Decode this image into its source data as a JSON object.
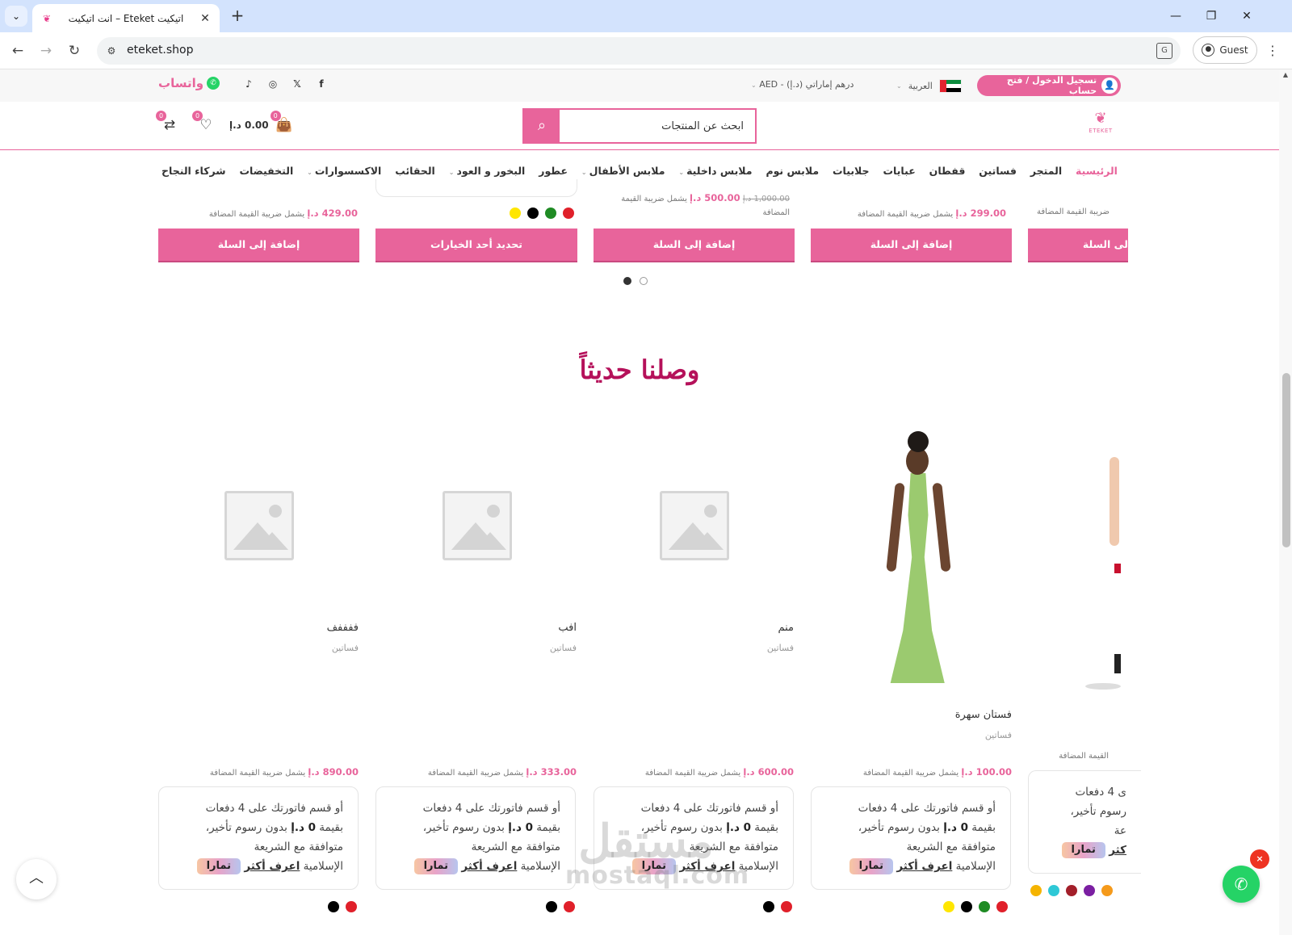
{
  "browser": {
    "tab_title": "اتيكيت Eteket – انت اتيكيت",
    "url": "eteket.shop",
    "guest_label": "Guest"
  },
  "topbar": {
    "login_label": "تسجيل الدخول / فتح حساب",
    "language": "العربية",
    "currency": "درهم إماراتي (د.إ) - AED",
    "whatsapp_label": "واتساب",
    "socials": [
      "facebook-icon",
      "x-icon",
      "instagram-icon",
      "tiktok-icon"
    ]
  },
  "header": {
    "logo_text": "ETEKET",
    "search_placeholder": "ابحث عن المنتجات",
    "cart_total": "0.00 د.إ",
    "cart_count": "0",
    "wishlist_count": "0",
    "compare_count": "0"
  },
  "nav": {
    "items": [
      {
        "label": "الرئيسية",
        "active": true
      },
      {
        "label": "المتجر"
      },
      {
        "label": "فساتين"
      },
      {
        "label": "قفطان"
      },
      {
        "label": "عبايات"
      },
      {
        "label": "جلابيات"
      },
      {
        "label": "ملابس نوم"
      },
      {
        "label": "ملابس داخلية",
        "dropdown": true
      },
      {
        "label": "ملابس الأطفال",
        "dropdown": true
      },
      {
        "label": "عطور"
      },
      {
        "label": "البخور و العود",
        "dropdown": true
      },
      {
        "label": "الحقائب"
      },
      {
        "label": "الاكسسوارات",
        "dropdown": true
      },
      {
        "label": "التخفيضات"
      },
      {
        "label": "شركاء النجاح"
      }
    ]
  },
  "carousel_top": {
    "vat_text": "يشمل ضريبة القيمة المضافة",
    "vat_partial": "ضريبة القيمة المضافة",
    "vat_split_1": "يشمل ضريبة القيمة",
    "vat_split_2": "المضافة",
    "currency": "د.إ",
    "prices": [
      "429.00",
      "500.00",
      "299.00"
    ],
    "old_price": "1,000.00",
    "add_to_cart": "إضافة إلى السلة",
    "add_to_cart_partial": "لى السلة",
    "choose_options": "تحديد أحد الخيارات",
    "swatch_colors": [
      "#ffe600",
      "#000000",
      "#1f8b24",
      "#e0202a"
    ]
  },
  "section": {
    "title": "وصلنا حديثاً"
  },
  "products": [
    {
      "name": "ففففف",
      "category": "فساتين",
      "price": "890.00",
      "swatches": [
        "#000000",
        "#e0202a"
      ]
    },
    {
      "name": "افب",
      "category": "فساتين",
      "price": "333.00",
      "swatches": [
        "#000000",
        "#e0202a"
      ]
    },
    {
      "name": "منم",
      "category": "فساتين",
      "price": "600.00",
      "swatches": [
        "#000000",
        "#e0202a"
      ]
    },
    {
      "name": "فستان سهرة",
      "category": "فساتين",
      "price": "100.00",
      "swatches": [
        "#ffe600",
        "#000000",
        "#1f8b24",
        "#e0202a"
      ]
    }
  ],
  "edge_product": {
    "vat_partial": "القيمة المضافة",
    "tamara_l1": "ى 4 دفعات",
    "tamara_l2": "رسوم تأخير،",
    "tamara_l3": "عة",
    "learn_partial": "كثر",
    "swatches": [
      "#f5b400",
      "#2ec8d6",
      "#a31f2a",
      "#7b1fa2",
      "#f59a1b",
      "#2ec8d6"
    ]
  },
  "tamara": {
    "line1": "أو قسم فاتورتك على 4 دفعات",
    "line2_prefix": "بقيمة",
    "amount": "0 د.إ",
    "line2_suffix": "بدون رسوم تأخير،",
    "line3": "متوافقة مع الشريعة",
    "line4": "الإسلامية",
    "learn_more": "اعرف أكثر",
    "logo": "تمارا"
  },
  "watermark": {
    "ar": "مستقل",
    "en": "mostaql.com"
  },
  "floating": {
    "close": "×"
  },
  "colors": {
    "brand_pink": "#e8649b",
    "title_magenta": "#b5115a",
    "whatsapp": "#25d366"
  }
}
